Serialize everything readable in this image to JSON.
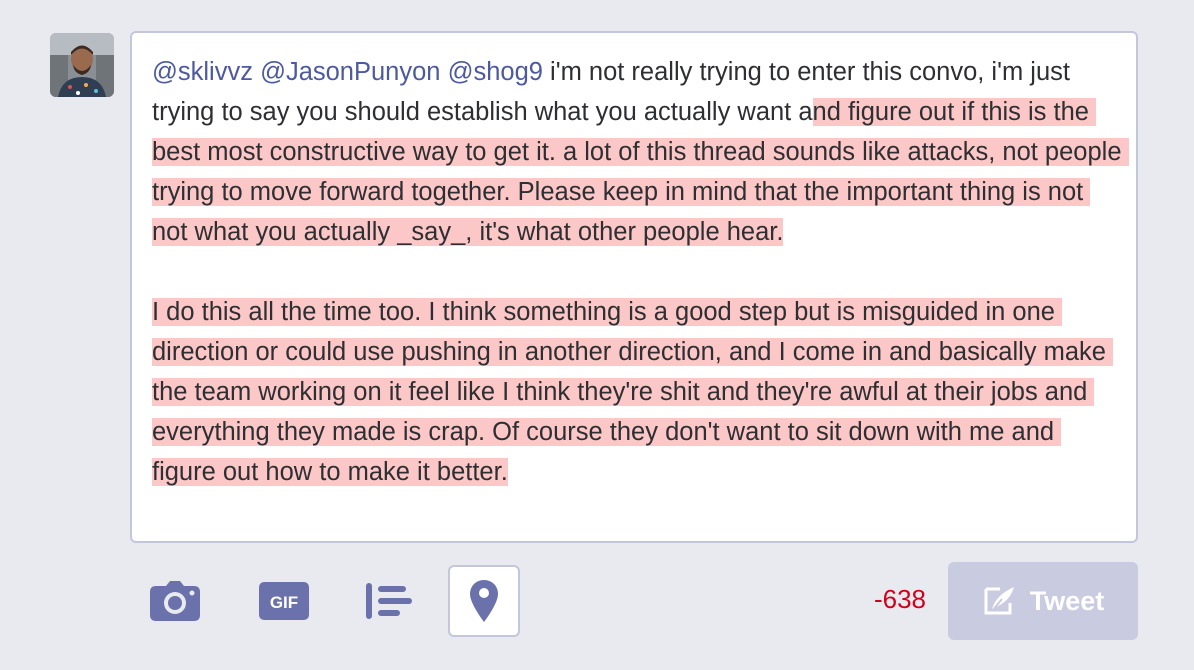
{
  "compose": {
    "mentions": [
      "@sklivvz",
      "@JasonPunyon",
      "@shog9"
    ],
    "text_within_limit": " i'm not really trying to enter this convo, i'm just trying to say you should establish what you actually want a",
    "text_over_limit": "nd figure out if this is the best most constructive way to get it. a lot of this thread sounds like attacks, not people trying to move forward together. Please keep in mind that the important thing is not not what you actually _say_, it's what other people hear.\n\nI do this all the time too. I think something is a good step but is misguided in one direction or could use pushing in another direction, and I come in and basically make the team working on it feel like I think they're shit and they're awful at their jobs and everything they made is crap. Of course they don't want to sit down with me and figure out how to make it better."
  },
  "toolbar": {
    "icons": [
      "camera-icon",
      "gif-icon",
      "poll-icon",
      "location-pin-icon"
    ],
    "gif_label": "GIF"
  },
  "char_counter": "-638",
  "tweet_button": {
    "label": "Tweet",
    "icon": "feather-pen-icon"
  },
  "colors": {
    "background": "#e9eaf0",
    "accent": "#6b72ab",
    "over_limit_highlight": "#fbc7c7",
    "counter_negative": "#d0021b",
    "button_disabled": "#c9cbe1"
  }
}
